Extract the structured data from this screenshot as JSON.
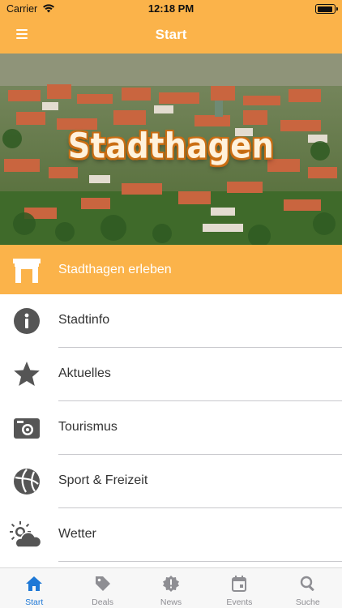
{
  "status_bar": {
    "carrier": "Carrier",
    "time": "12:18 PM",
    "battery_level": 0.95
  },
  "nav": {
    "title": "Start",
    "menu_icon": "hamburger-menu-icon"
  },
  "hero": {
    "title": "Stadthagen"
  },
  "highlight": {
    "label": "Stadthagen erleben",
    "icon": "gate-icon"
  },
  "menu": [
    {
      "label": "Stadtinfo",
      "icon": "info-icon"
    },
    {
      "label": "Aktuelles",
      "icon": "star-icon"
    },
    {
      "label": "Tourismus",
      "icon": "camera-icon"
    },
    {
      "label": "Sport & Freizeit",
      "icon": "volleyball-icon"
    },
    {
      "label": "Wetter",
      "icon": "weather-icon"
    }
  ],
  "tabs": [
    {
      "label": "Start",
      "icon": "home-icon",
      "active": true
    },
    {
      "label": "Deals",
      "icon": "tag-icon",
      "active": false
    },
    {
      "label": "News",
      "icon": "news-alert-icon",
      "active": false
    },
    {
      "label": "Events",
      "icon": "calendar-icon",
      "active": false
    },
    {
      "label": "Suche",
      "icon": "search-icon",
      "active": false
    }
  ],
  "colors": {
    "brand_orange": "#fbb34a",
    "tab_active": "#1e78d6",
    "tab_inactive": "#8e8e93",
    "icon_gray": "#555555"
  }
}
